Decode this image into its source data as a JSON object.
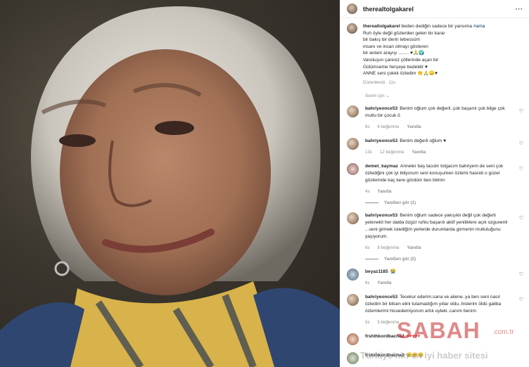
{
  "post": {
    "username": "therealtolgakarel"
  },
  "caption": {
    "lines": [
      "beden dediğin sadece bir yansıma",
      "#ama",
      "Ruh öyle değil gözlerden gelen bir karar",
      "bir bakış bir derin tebessüm",
      "insanı ve insan olmayı gösteren",
      "bir anlam arayışı ........ ♥🙏🌍",
      "Varoluşun çaresiz çöllerinde açan bir",
      "Gülümseme herşeye bedeldir ♥",
      "ANNE seni çokkk özledim 👏🙏😞♥"
    ],
    "edited": "Düzenlendi · 11s"
  },
  "hide_replies_label": "Senin için ⌄",
  "comments": [
    {
      "username": "bahriyeonce53",
      "text": "Benim oğlum çok değerli..çok başarılı çok bilge çok mutlu bir çocuk ö",
      "time": "6s",
      "likes": "6 beğenme",
      "reply": "Yanıtla"
    },
    {
      "username": "bahriyeonce53",
      "text": "Benim değerli oğlum ♥",
      "time": "13s",
      "likes": "12 beğenme",
      "reply": "Yanıtla"
    },
    {
      "username": "demet_kaymaz",
      "text": "Anneler baş tacıdır tolgacım bahriyem de seni çok özlediğini çok iyi biliyorum seni konuşurken özlemi hasreti o güzel gözlerinde kaç kere gördüm ben bilirim",
      "time": "4s",
      "likes": "",
      "reply": "Yanıtla",
      "replies": "Yanıtları gör (1)"
    },
    {
      "username": "bahriyeonce53",
      "text": "Benim oğlum sadece yakışıklı değil çok değerli yetenekli her dalda özgür ruhlu başarılı aktif yeniliklere açık ozguvenli ...seni girmek istediğim yerlerde durumlarda girmenin mutluluğunu yaşıyorum.",
      "time": "6s",
      "likes": "8 beğenme",
      "reply": "Yanıtla",
      "replies": "Yanıtları gör (2)"
    },
    {
      "username": "beyaz1185",
      "text": "😭",
      "time": "6s",
      "likes": "",
      "reply": "Yanıtla"
    },
    {
      "username": "bahriyeonce53",
      "text": "Tesekur ederim.sana ve ailene..ya ben seni nasıl özledim bir bilsen elini tutamadığım yıllar oldu..hislerim öldü galiba özlemlerimi hissedemiyorum artık oyleki..canım benim",
      "time": "5s",
      "likes": "5 beğenme",
      "reply": ""
    },
    {
      "username": "frshthkordbache2",
      "text": "♥♥♥♥♥",
      "time": "",
      "likes": "",
      "reply": ""
    },
    {
      "username": "frshthkordbache2",
      "text": "😢😢😢",
      "time": "",
      "likes": "",
      "reply": ""
    }
  ],
  "watermark": {
    "brand": "SABAH",
    "tld": ".com.tr",
    "tagline": "Türkiye'nin en iyi haber sitesi"
  },
  "colors": {
    "heart": "#ed4956",
    "link": "#00376b",
    "muted": "#8e8e8e",
    "watermark": "#c42828"
  }
}
